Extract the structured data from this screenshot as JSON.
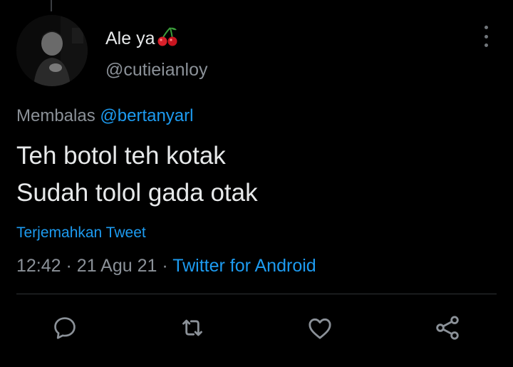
{
  "author": {
    "display_name": "Ale ya",
    "handle": "@cutieianloy",
    "badge_emoji_icon": "cherries-icon"
  },
  "reply": {
    "prefix": "Membalas",
    "mention": "@bertanyarl"
  },
  "tweet": {
    "lines": [
      "Teh botol teh kotak",
      "Sudah tolol gada otak"
    ]
  },
  "translate_label": "Terjemahkan Tweet",
  "meta": {
    "time": "12:42",
    "separator": "·",
    "date": "21 Agu 21",
    "source": "Twitter for Android"
  },
  "actions": [
    "reply-icon",
    "retweet-icon",
    "like-icon",
    "share-icon"
  ],
  "colors": {
    "background": "#000000",
    "text_primary": "#e7e9ea",
    "text_secondary": "#8b9198",
    "link": "#1d9bf0",
    "divider": "#2f3336"
  }
}
